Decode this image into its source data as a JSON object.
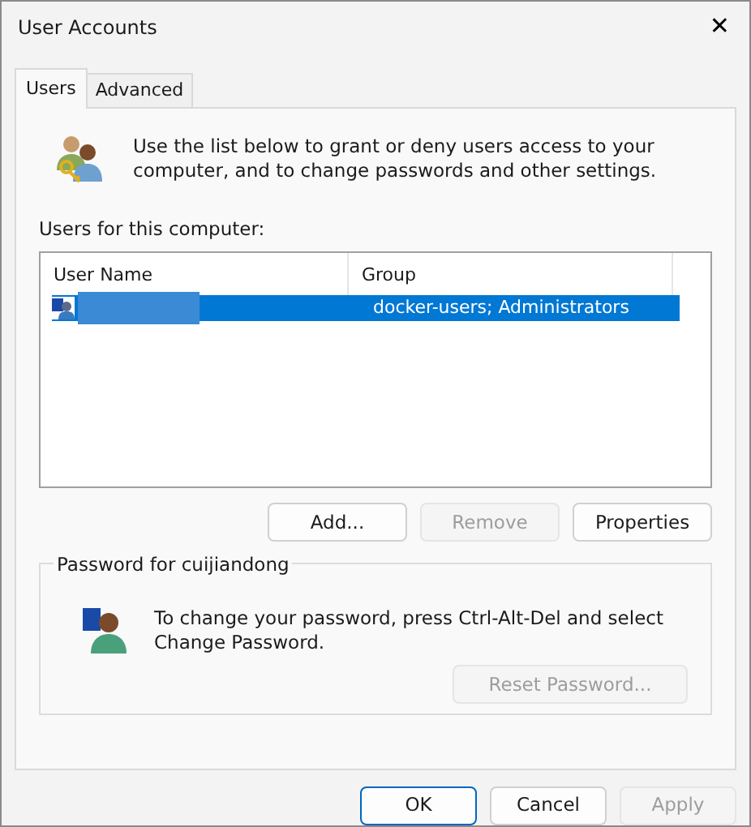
{
  "window": {
    "title": "User Accounts",
    "close": "✕"
  },
  "tabs": [
    {
      "label": "Users",
      "selected": true
    },
    {
      "label": "Advanced",
      "selected": false
    }
  ],
  "intro": "Use the list below to grant or deny users access to your computer, and to change passwords and other settings.",
  "list_label": "Users for this computer:",
  "table": {
    "columns": [
      "User Name",
      "Group"
    ],
    "rows": [
      {
        "redacted": true,
        "group": "docker-users; Administrators",
        "selected": true
      }
    ]
  },
  "list_buttons": [
    {
      "label": "Add...",
      "disabled": false
    },
    {
      "label": "Remove",
      "disabled": true
    },
    {
      "label": "Properties",
      "disabled": false
    }
  ],
  "password_group": {
    "title": "Password for cuijiandong",
    "text": "To change your password, press Ctrl-Alt-Del and select Change Password.",
    "button": {
      "label": "Reset Password...",
      "disabled": true
    }
  },
  "footer_buttons": [
    {
      "label": "OK",
      "disabled": false,
      "default": true
    },
    {
      "label": "Cancel",
      "disabled": false,
      "default": false
    },
    {
      "label": "Apply",
      "disabled": true,
      "default": false
    }
  ]
}
